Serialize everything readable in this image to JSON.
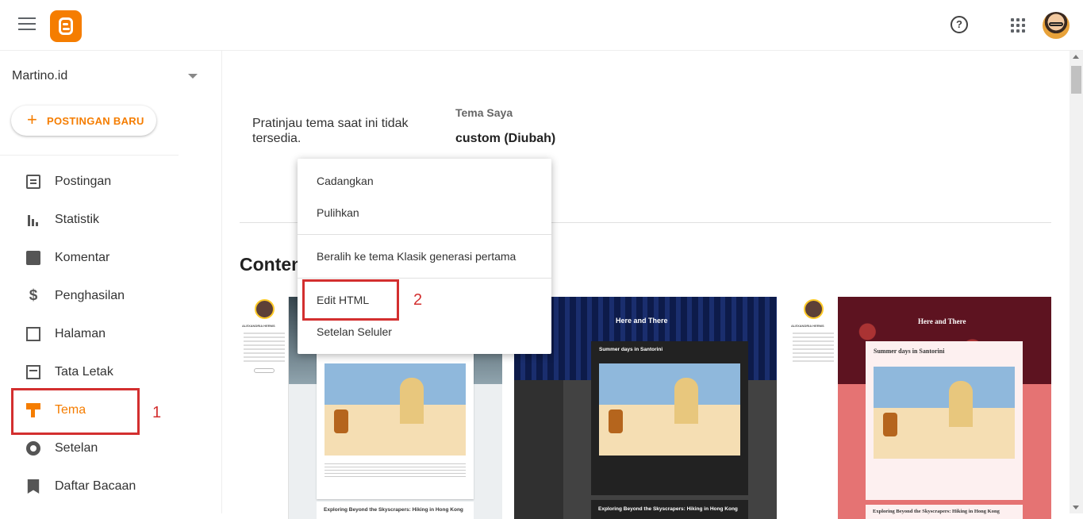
{
  "header": {
    "menu_icon": "hamburger-icon",
    "logo_icon": "blogger-logo",
    "help_icon": "help-icon",
    "apps_icon": "apps-grid-icon"
  },
  "sidebar": {
    "blog_name": "Martino.id",
    "new_post_label": "POSTINGAN BARU",
    "items": [
      {
        "label": "Postingan",
        "icon": "posts-icon"
      },
      {
        "label": "Statistik",
        "icon": "stats-icon"
      },
      {
        "label": "Komentar",
        "icon": "comment-icon"
      },
      {
        "label": "Penghasilan",
        "icon": "dollar-icon"
      },
      {
        "label": "Halaman",
        "icon": "pages-icon"
      },
      {
        "label": "Tata Letak",
        "icon": "layout-icon"
      },
      {
        "label": "Tema",
        "icon": "theme-icon",
        "active": true
      },
      {
        "label": "Setelan",
        "icon": "settings-icon"
      },
      {
        "label": "Daftar Bacaan",
        "icon": "bookmark-icon"
      }
    ],
    "annotation": "1"
  },
  "main": {
    "preview_unavailable": "Pratinjau tema saat ini tidak tersedia.",
    "my_theme_label": "Tema Saya",
    "my_theme_name": "custom (Diubah)",
    "section_heading": "Conten",
    "cards": [
      {
        "title": "",
        "post_title": "Exploring Beyond the Skyscrapers: Hiking in Hong Kong",
        "author": "ALEXANDRIA HERMS"
      },
      {
        "title": "Here and There",
        "post_title": "Summer days in Santorini",
        "post_title_2": "Exploring Beyond the Skyscrapers: Hiking in Hong Kong"
      },
      {
        "title": "Here and There",
        "post_title": "Summer days in Santorini",
        "post_title_2": "Exploring Beyond the Skyscrapers: Hiking in Hong Kong",
        "author": "ALEXANDRIA HERMS"
      }
    ]
  },
  "menu": {
    "items": [
      {
        "label": "Cadangkan"
      },
      {
        "label": "Pulihkan"
      },
      {
        "label": "Beralih ke tema Klasik generasi pertama"
      },
      {
        "label": "Edit HTML"
      },
      {
        "label": "Setelan Seluler"
      }
    ],
    "annotation": "2"
  },
  "colors": {
    "accent": "#f57d00",
    "annotation": "#d32f2f"
  }
}
